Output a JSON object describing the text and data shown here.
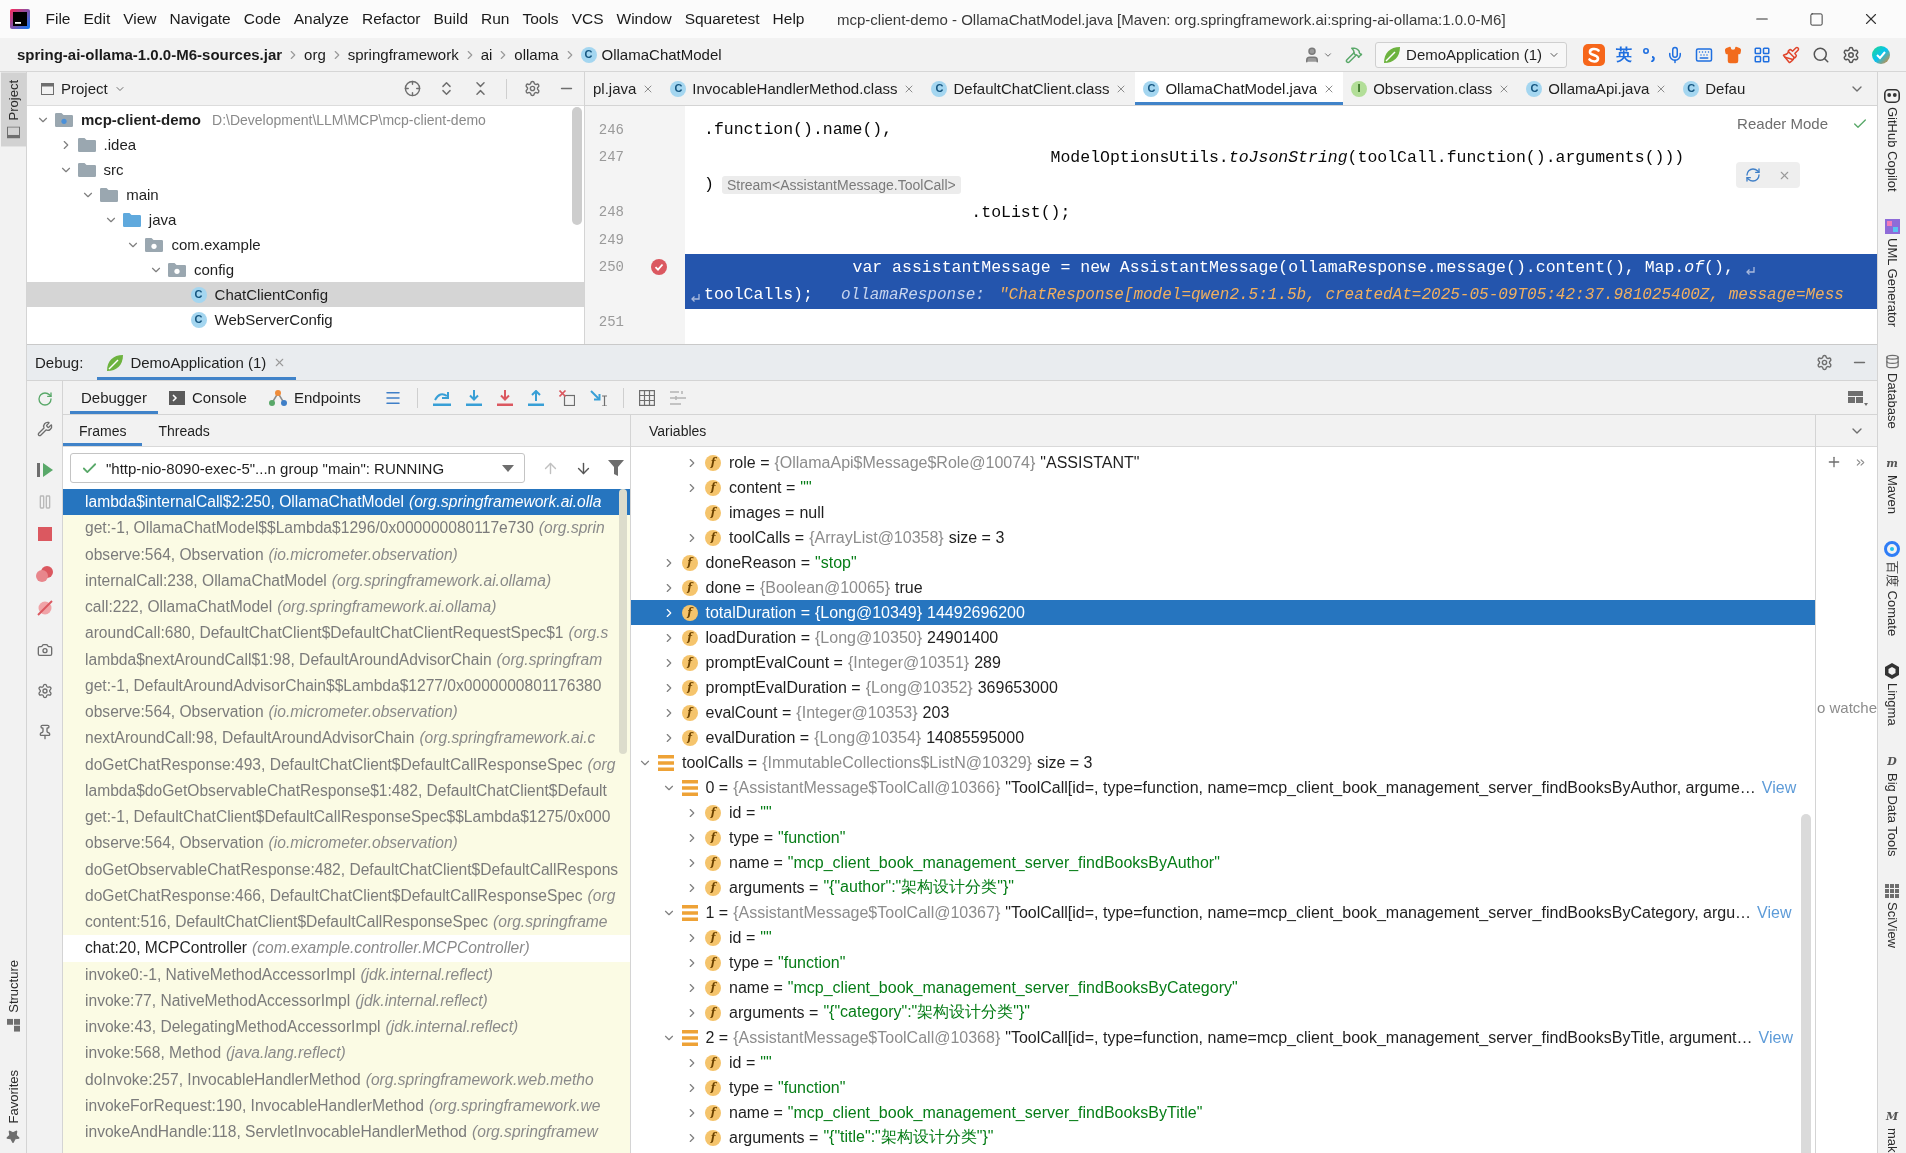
{
  "menu_bar": {
    "items": [
      "File",
      "Edit",
      "View",
      "Navigate",
      "Code",
      "Analyze",
      "Refactor",
      "Build",
      "Run",
      "Tools",
      "VCS",
      "Window",
      "Squaretest",
      "Help"
    ],
    "title": "mcp-client-demo - OllamaChatModel.java [Maven: org.springframework.ai:spring-ai-ollama:1.0.0-M6]"
  },
  "nav_bar": {
    "breadcrumbs": [
      {
        "label": "spring-ai-ollama-1.0.0-M6-sources.jar",
        "kind": "jar"
      },
      {
        "label": "org",
        "kind": "package"
      },
      {
        "label": "springframework",
        "kind": "package"
      },
      {
        "label": "ai",
        "kind": "package"
      },
      {
        "label": "ollama",
        "kind": "package"
      },
      {
        "label": "OllamaChatModel",
        "kind": "class",
        "icon": "C"
      }
    ],
    "run_config": "DemoApplication (1)",
    "ime_mode": "英"
  },
  "left_strip": {
    "top_tabs": [
      {
        "label": "Project",
        "kind": "project",
        "selected": true
      }
    ],
    "bottom_tabs": [
      {
        "label": "Structure",
        "kind": "structure",
        "selected": false
      },
      {
        "label": "Favorites",
        "kind": "favorites",
        "selected": false
      }
    ]
  },
  "project_panel": {
    "title": "Project",
    "tree": [
      {
        "label": "mcp-client-demo",
        "kind": "module",
        "path": "D:\\Development\\LLM\\MCP\\mcp-client-demo",
        "expanded": true,
        "selected": false,
        "children": [
          {
            "label": ".idea",
            "kind": "folder",
            "expanded": false,
            "selected": false
          },
          {
            "label": "src",
            "kind": "folder",
            "expanded": true,
            "selected": false,
            "children": [
              {
                "label": "main",
                "kind": "folder",
                "expanded": true,
                "selected": false,
                "children": [
                  {
                    "label": "java",
                    "kind": "source_folder",
                    "expanded": true,
                    "selected": false,
                    "children": [
                      {
                        "label": "com.example",
                        "kind": "package",
                        "expanded": true,
                        "selected": false,
                        "children": [
                          {
                            "label": "config",
                            "kind": "package",
                            "expanded": true,
                            "selected": false,
                            "children": [
                              {
                                "label": "ChatClientConfig",
                                "kind": "class",
                                "icon": "C",
                                "selected": true
                              },
                              {
                                "label": "WebServerConfig",
                                "kind": "class",
                                "icon": "C",
                                "selected": false
                              }
                            ]
                          }
                        ]
                      }
                    ]
                  }
                ]
              }
            ]
          }
        ]
      }
    ]
  },
  "editor": {
    "tabs": [
      {
        "label": "pl.java",
        "selected": false,
        "closable": true
      },
      {
        "label": "InvocableHandlerMethod.class",
        "kind": "class",
        "icon": "C",
        "selected": false,
        "closable": true
      },
      {
        "label": "DefaultChatClient.class",
        "kind": "class",
        "icon": "C",
        "selected": false,
        "closable": true
      },
      {
        "label": "OllamaChatModel.java",
        "kind": "class",
        "icon": "C",
        "selected": true,
        "closable": true
      },
      {
        "label": "Observation.class",
        "kind": "interface",
        "icon": "I",
        "selected": false,
        "closable": true
      },
      {
        "label": "OllamaApi.java",
        "kind": "class",
        "icon": "C",
        "selected": false,
        "closable": true
      },
      {
        "label": "Defau",
        "kind": "class",
        "icon": "C",
        "selected": false,
        "closable": false
      }
    ],
    "reader_mode": "Reader Mode",
    "lines": [
      {
        "number": "246",
        "kind": "code",
        "text": ".function().name(),",
        "current": false,
        "breakpoint": false
      },
      {
        "number": "247",
        "kind": "code",
        "text": "                                   ModelOptionsUtils.*toJsonString*(toolCall.function().arguments()))",
        "current": false,
        "breakpoint": false
      },
      {
        "kind": "hint",
        "text": ")",
        "hint": "Stream<AssistantMessage.ToolCall>",
        "current": false,
        "breakpoint": false
      },
      {
        "number": "248",
        "kind": "code",
        "text": "                           .toList();",
        "current": false,
        "breakpoint": false
      },
      {
        "number": "249",
        "kind": "code",
        "current": false,
        "breakpoint": false
      },
      {
        "number": "250",
        "kind": "code",
        "text": "               var assistantMessage = new AssistantMessage(ollamaResponse.message().content(), Map.*of*(),",
        "wrap": "toolCalls);",
        "inline_value": {
          "name": "ollamaResponse:",
          "value": "\"ChatResponse[model=qwen2.5:1.5b, createdAt=2025-05-09T05:42:37.981025400Z, message=Mess"
        },
        "current": true,
        "breakpoint": true
      },
      {
        "number": "251",
        "kind": "code",
        "current": false,
        "breakpoint": false
      }
    ]
  },
  "debug": {
    "title": "Debug:",
    "sessions": [
      {
        "label": "DemoApplication (1)",
        "selected": true
      }
    ],
    "tabs": [
      {
        "label": "Debugger",
        "kind": "debugger",
        "selected": true
      },
      {
        "label": "Console",
        "kind": "console",
        "selected": false
      },
      {
        "label": "Endpoints",
        "kind": "endpoints",
        "selected": false
      }
    ],
    "frames_tabs": [
      {
        "label": "Frames",
        "selected": true
      },
      {
        "label": "Threads",
        "selected": false
      }
    ],
    "thread": "\"http-nio-8090-exec-5\"...n group \"main\": RUNNING",
    "frames": [
      {
        "method": "lambda$internalCall$2:250, OllamaChatModel",
        "package": "(org.springframework.ai.olla",
        "library": true,
        "selected": true
      },
      {
        "method": "get:-1, OllamaChatModel$$Lambda$1296/0x000000080117e730",
        "package": "(org.sprin",
        "library": true,
        "selected": false
      },
      {
        "method": "observe:564, Observation",
        "package": "(io.micrometer.observation)",
        "library": true,
        "selected": false
      },
      {
        "method": "internalCall:238, OllamaChatModel",
        "package": "(org.springframework.ai.ollama)",
        "library": true,
        "selected": false
      },
      {
        "method": "call:222, OllamaChatModel",
        "package": "(org.springframework.ai.ollama)",
        "library": true,
        "selected": false
      },
      {
        "method": "aroundCall:680, DefaultChatClient$DefaultChatClientRequestSpec$1",
        "package": "(org.s",
        "library": true,
        "selected": false
      },
      {
        "method": "lambda$nextAroundCall$1:98, DefaultAroundAdvisorChain",
        "package": "(org.springfram",
        "library": true,
        "selected": false
      },
      {
        "method": "get:-1, DefaultAroundAdvisorChain$$Lambda$1277/0x0000000801176380",
        "library": true,
        "selected": false
      },
      {
        "method": "observe:564, Observation",
        "package": "(io.micrometer.observation)",
        "library": true,
        "selected": false
      },
      {
        "method": "nextAroundCall:98, DefaultAroundAdvisorChain",
        "package": "(org.springframework.ai.c",
        "library": true,
        "selected": false
      },
      {
        "method": "doGetChatResponse:493, DefaultChatClient$DefaultCallResponseSpec",
        "package": "(org",
        "library": true,
        "selected": false
      },
      {
        "method": "lambda$doGetObservableChatResponse$1:482, DefaultChatClient$Default",
        "library": true,
        "selected": false
      },
      {
        "method": "get:-1, DefaultChatClient$DefaultCallResponseSpec$$Lambda$1275/0x000",
        "library": true,
        "selected": false
      },
      {
        "method": "observe:564, Observation",
        "package": "(io.micrometer.observation)",
        "library": true,
        "selected": false
      },
      {
        "method": "doGetObservableChatResponse:482, DefaultChatClient$DefaultCallRespons",
        "library": true,
        "selected": false
      },
      {
        "method": "doGetChatResponse:466, DefaultChatClient$DefaultCallResponseSpec",
        "package": "(org",
        "library": true,
        "selected": false
      },
      {
        "method": "content:516, DefaultChatClient$DefaultCallResponseSpec",
        "package": "(org.springframe",
        "library": true,
        "selected": false
      },
      {
        "method": "chat:20, MCPController",
        "package": "(com.example.controller.MCPController)",
        "library": false,
        "selected": false
      },
      {
        "method": "invoke0:-1, NativeMethodAccessorImpl",
        "package": "(jdk.internal.reflect)",
        "library": true,
        "selected": false
      },
      {
        "method": "invoke:77, NativeMethodAccessorImpl",
        "package": "(jdk.internal.reflect)",
        "library": true,
        "selected": false
      },
      {
        "method": "invoke:43, DelegatingMethodAccessorImpl",
        "package": "(jdk.internal.reflect)",
        "library": true,
        "selected": false
      },
      {
        "method": "invoke:568, Method",
        "package": "(java.lang.reflect)",
        "library": true,
        "selected": false
      },
      {
        "method": "doInvoke:257, InvocableHandlerMethod",
        "package": "(org.springframework.web.metho",
        "library": true,
        "selected": false
      },
      {
        "method": "invokeForRequest:190, InvocableHandlerMethod",
        "package": "(org.springframework.we",
        "library": true,
        "selected": false
      },
      {
        "method": "invokeAndHandle:118, ServletInvocableHandlerMethod",
        "package": "(org.springframew",
        "library": true,
        "selected": false
      }
    ],
    "variables": {
      "title": "Variables",
      "tree": [
        {
          "kind": "continued",
          "children": [
            {
              "kind": "continued",
              "children": [
                {
                  "kind": "field",
                  "icon": "f",
                  "name": "role =",
                  "ref": "{OllamaApi$Message$Role@10074}",
                  "value": "\"ASSISTANT\"",
                  "string_value": false,
                  "expanded": false,
                  "selected": false
                },
                {
                  "kind": "field",
                  "icon": "f",
                  "name": "content =",
                  "value": "\"\"",
                  "string_value": true,
                  "expanded": false,
                  "selected": false
                },
                {
                  "kind": "field",
                  "icon": "f",
                  "name": "images =",
                  "value": "null",
                  "string_value": false,
                  "selected": false
                },
                {
                  "kind": "field",
                  "icon": "f",
                  "name": "toolCalls =",
                  "ref": "{ArrayList@10358}",
                  "value": "size = 3",
                  "string_value": false,
                  "expanded": false,
                  "selected": false
                }
              ]
            },
            {
              "kind": "field",
              "icon": "f",
              "name": "doneReason =",
              "value": "\"stop\"",
              "string_value": true,
              "expanded": false,
              "selected": false
            },
            {
              "kind": "field",
              "icon": "f",
              "name": "done =",
              "ref": "{Boolean@10065}",
              "value": "true",
              "string_value": false,
              "expanded": false,
              "selected": false
            },
            {
              "kind": "field",
              "icon": "f",
              "name": "totalDuration =",
              "ref": "{Long@10349}",
              "value": "14492696200",
              "string_value": false,
              "expanded": false,
              "selected": true
            },
            {
              "kind": "field",
              "icon": "f",
              "name": "loadDuration =",
              "ref": "{Long@10350}",
              "value": "24901400",
              "string_value": false,
              "expanded": false,
              "selected": false
            },
            {
              "kind": "field",
              "icon": "f",
              "name": "promptEvalCount =",
              "ref": "{Integer@10351}",
              "value": "289",
              "string_value": false,
              "expanded": false,
              "selected": false
            },
            {
              "kind": "field",
              "icon": "f",
              "name": "promptEvalDuration =",
              "ref": "{Long@10352}",
              "value": "369653000",
              "string_value": false,
              "expanded": false,
              "selected": false
            },
            {
              "kind": "field",
              "icon": "f",
              "name": "evalCount =",
              "ref": "{Integer@10353}",
              "value": "203",
              "string_value": false,
              "expanded": false,
              "selected": false
            },
            {
              "kind": "field",
              "icon": "f",
              "name": "evalDuration =",
              "ref": "{Long@10354}",
              "value": "14085595000",
              "string_value": false,
              "expanded": false,
              "selected": false
            }
          ]
        },
        {
          "kind": "list",
          "name": "toolCalls =",
          "ref": "{ImmutableCollections$ListN@10329}",
          "value": "size = 3",
          "string_value": false,
          "expanded": true,
          "selected": false,
          "children": [
            {
              "kind": "list",
              "name": "0 =",
              "ref": "{AssistantMessage$ToolCall@10366}",
              "value": "\"ToolCall[id=, type=function, name=mcp_client_book_management_server_findBooksByAuthor, argume…",
              "string_value": false,
              "link": "View",
              "expanded": true,
              "selected": false,
              "children": [
                {
                  "kind": "field",
                  "icon": "f",
                  "name": "id =",
                  "value": "\"\"",
                  "string_value": true,
                  "expanded": false,
                  "selected": false
                },
                {
                  "kind": "field",
                  "icon": "f",
                  "name": "type =",
                  "value": "\"function\"",
                  "string_value": true,
                  "expanded": false,
                  "selected": false
                },
                {
                  "kind": "field",
                  "icon": "f",
                  "name": "name =",
                  "value": "\"mcp_client_book_management_server_findBooksByAuthor\"",
                  "string_value": true,
                  "expanded": false,
                  "selected": false
                },
                {
                  "kind": "field",
                  "icon": "f",
                  "name": "arguments =",
                  "value": "\"{\"author\":\"架构设计分类\"}\"",
                  "string_value": true,
                  "expanded": false,
                  "selected": false
                }
              ]
            },
            {
              "kind": "list",
              "name": "1 =",
              "ref": "{AssistantMessage$ToolCall@10367}",
              "value": "\"ToolCall[id=, type=function, name=mcp_client_book_management_server_findBooksByCategory, argu…",
              "string_value": false,
              "link": "View",
              "expanded": true,
              "selected": false,
              "children": [
                {
                  "kind": "field",
                  "icon": "f",
                  "name": "id =",
                  "value": "\"\"",
                  "string_value": true,
                  "expanded": false,
                  "selected": false
                },
                {
                  "kind": "field",
                  "icon": "f",
                  "name": "type =",
                  "value": "\"function\"",
                  "string_value": true,
                  "expanded": false,
                  "selected": false
                },
                {
                  "kind": "field",
                  "icon": "f",
                  "name": "name =",
                  "value": "\"mcp_client_book_management_server_findBooksByCategory\"",
                  "string_value": true,
                  "expanded": false,
                  "selected": false
                },
                {
                  "kind": "field",
                  "icon": "f",
                  "name": "arguments =",
                  "value": "\"{\"category\":\"架构设计分类\"}\"",
                  "string_value": true,
                  "expanded": false,
                  "selected": false
                }
              ]
            },
            {
              "kind": "list",
              "name": "2 =",
              "ref": "{AssistantMessage$ToolCall@10368}",
              "value": "\"ToolCall[id=, type=function, name=mcp_client_book_management_server_findBooksByTitle, argument…",
              "string_value": false,
              "link": "View",
              "expanded": true,
              "selected": false,
              "children": [
                {
                  "kind": "field",
                  "icon": "f",
                  "name": "id =",
                  "value": "\"\"",
                  "string_value": true,
                  "expanded": false,
                  "selected": false
                },
                {
                  "kind": "field",
                  "icon": "f",
                  "name": "type =",
                  "value": "\"function\"",
                  "string_value": true,
                  "expanded": false,
                  "selected": false
                },
                {
                  "kind": "field",
                  "icon": "f",
                  "name": "name =",
                  "value": "\"mcp_client_book_management_server_findBooksByTitle\"",
                  "string_value": true,
                  "expanded": false,
                  "selected": false
                },
                {
                  "kind": "field",
                  "icon": "f",
                  "name": "arguments =",
                  "value": "\"{\"title\":\"架构设计分类\"}\"",
                  "string_value": true,
                  "expanded": false,
                  "selected": false
                }
              ]
            }
          ]
        }
      ]
    },
    "watches": {
      "empty_text": "o watche"
    }
  },
  "right_strip": {
    "tools": [
      {
        "label": "GitHub Copilot",
        "kind": "copilot"
      },
      {
        "label": "UML Generator",
        "kind": "uml"
      },
      {
        "label": "Database",
        "kind": "database"
      },
      {
        "label": "Maven",
        "kind": "letter",
        "icon": "m"
      },
      {
        "label": "百度 Comate",
        "kind": "comate"
      },
      {
        "label": "Lingma",
        "kind": "lingma"
      },
      {
        "label": "Big Data Tools",
        "kind": "letter",
        "icon": "D"
      },
      {
        "label": "SciView",
        "kind": "sciview"
      }
    ],
    "bottom_tools": [
      {
        "label": "mak",
        "kind": "letter",
        "icon": "M"
      }
    ]
  }
}
